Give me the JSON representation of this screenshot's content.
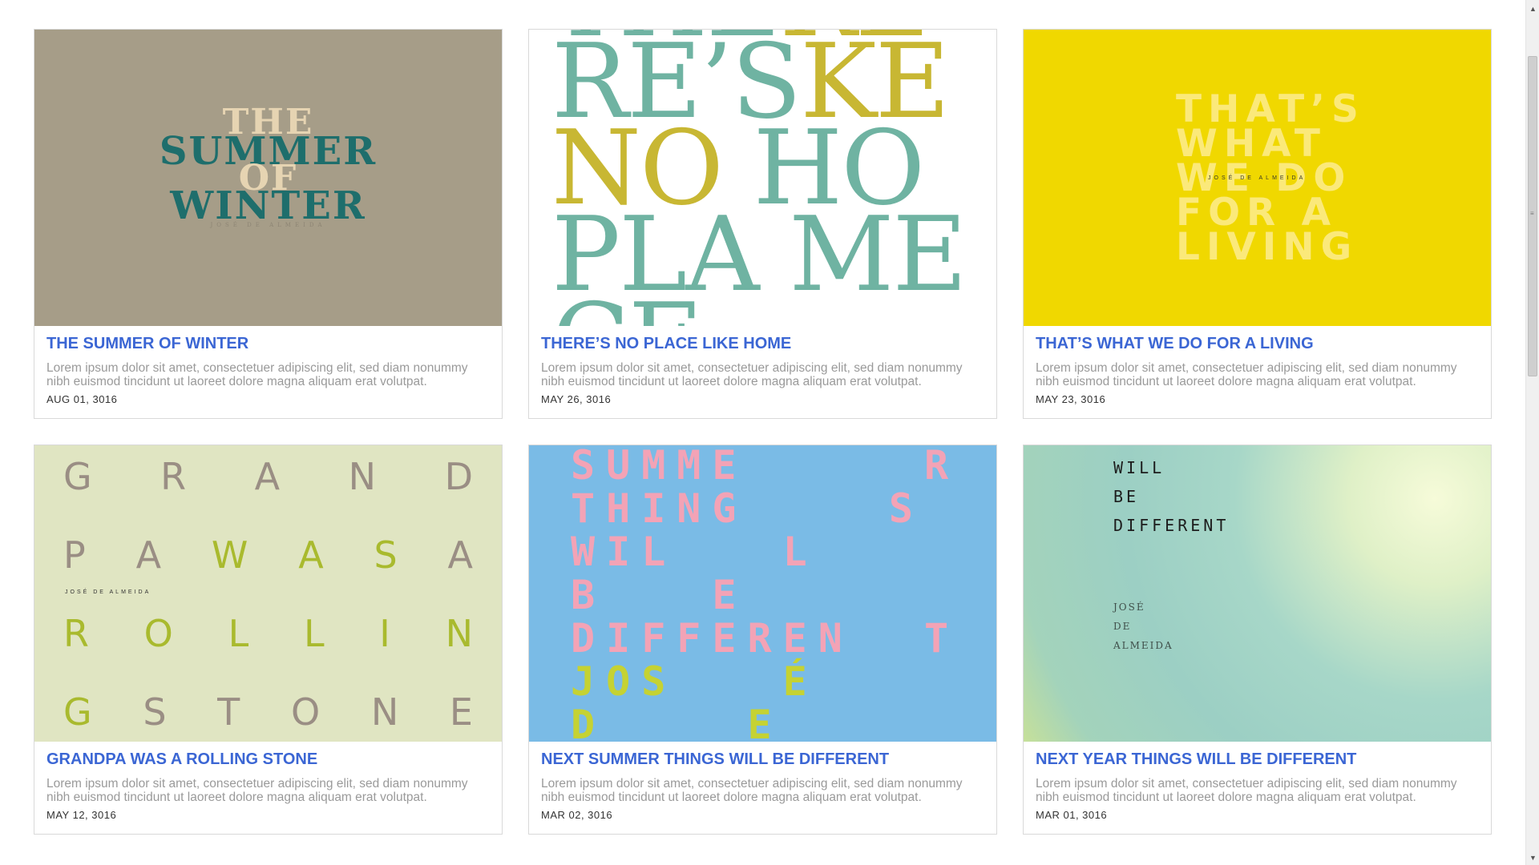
{
  "cards": [
    {
      "title": "THE SUMMER OF WINTER",
      "desc": "Lorem ipsum dolor sit amet, consectetuer adipiscing elit, sed diam nonummy nibh euismod tincidunt ut laoreet dolore magna aliquam erat volutpat.",
      "date": "AUG 01, 3016",
      "thumb_lines": [
        "THE",
        "SUMMER",
        "OF",
        "WINTER"
      ],
      "thumb_sub": "JOSÉ DE ALMEIDA"
    },
    {
      "title": "THERE’S NO PLACE LIKE HOME",
      "desc": "Lorem ipsum dolor sit amet, consectetuer adipiscing elit, sed diam nonummy nibh euismod tincidunt ut laoreet dolore magna aliquam erat volutpat.",
      "date": "MAY 26, 3016"
    },
    {
      "title": "THAT’S WHAT WE DO FOR A LIVING",
      "desc": "Lorem ipsum dolor sit amet, consectetuer adipiscing elit, sed diam nonummy nibh euismod tincidunt ut laoreet dolore magna aliquam erat volutpat.",
      "date": "MAY 23, 3016",
      "thumb_lines": [
        "THAT’S",
        "WHAT",
        "WE DO",
        "FOR A",
        "LIVING"
      ],
      "thumb_sub": "JOSÉ DE ALMEIDA"
    },
    {
      "title": "GRANDPA WAS A ROLLING STONE",
      "desc": "Lorem ipsum dolor sit amet, consectetuer adipiscing elit, sed diam nonummy nibh euismod tincidunt ut laoreet dolore magna aliquam erat volutpat.",
      "date": "MAY 12, 3016",
      "thumb_sub": "JOSÉ DE ALMEIDA"
    },
    {
      "title": "NEXT SUMMER THINGS WILL BE DIFFERENT",
      "desc": "Lorem ipsum dolor sit amet, consectetuer adipiscing elit, sed diam nonummy nibh euismod tincidunt ut laoreet dolore magna aliquam erat volutpat.",
      "date": "MAR 02, 3016"
    },
    {
      "title": "NEXT YEAR THINGS WILL BE DIFFERENT",
      "desc": "Lorem ipsum dolor sit amet, consectetuer adipiscing elit, sed diam nonummy nibh euismod tincidunt ut laoreet dolore magna aliquam erat volutpat.",
      "date": "MAR 01, 3016",
      "thumb_lines": [
        "WILL",
        "BE",
        "DIFFERENT"
      ],
      "thumb_sub_lines": [
        "JOSÉ",
        "DE",
        "ALMEIDA"
      ]
    }
  ],
  "colors": {
    "title": "#3b66d4",
    "desc": "#9a9a9a",
    "border": "#d9d9d9"
  }
}
